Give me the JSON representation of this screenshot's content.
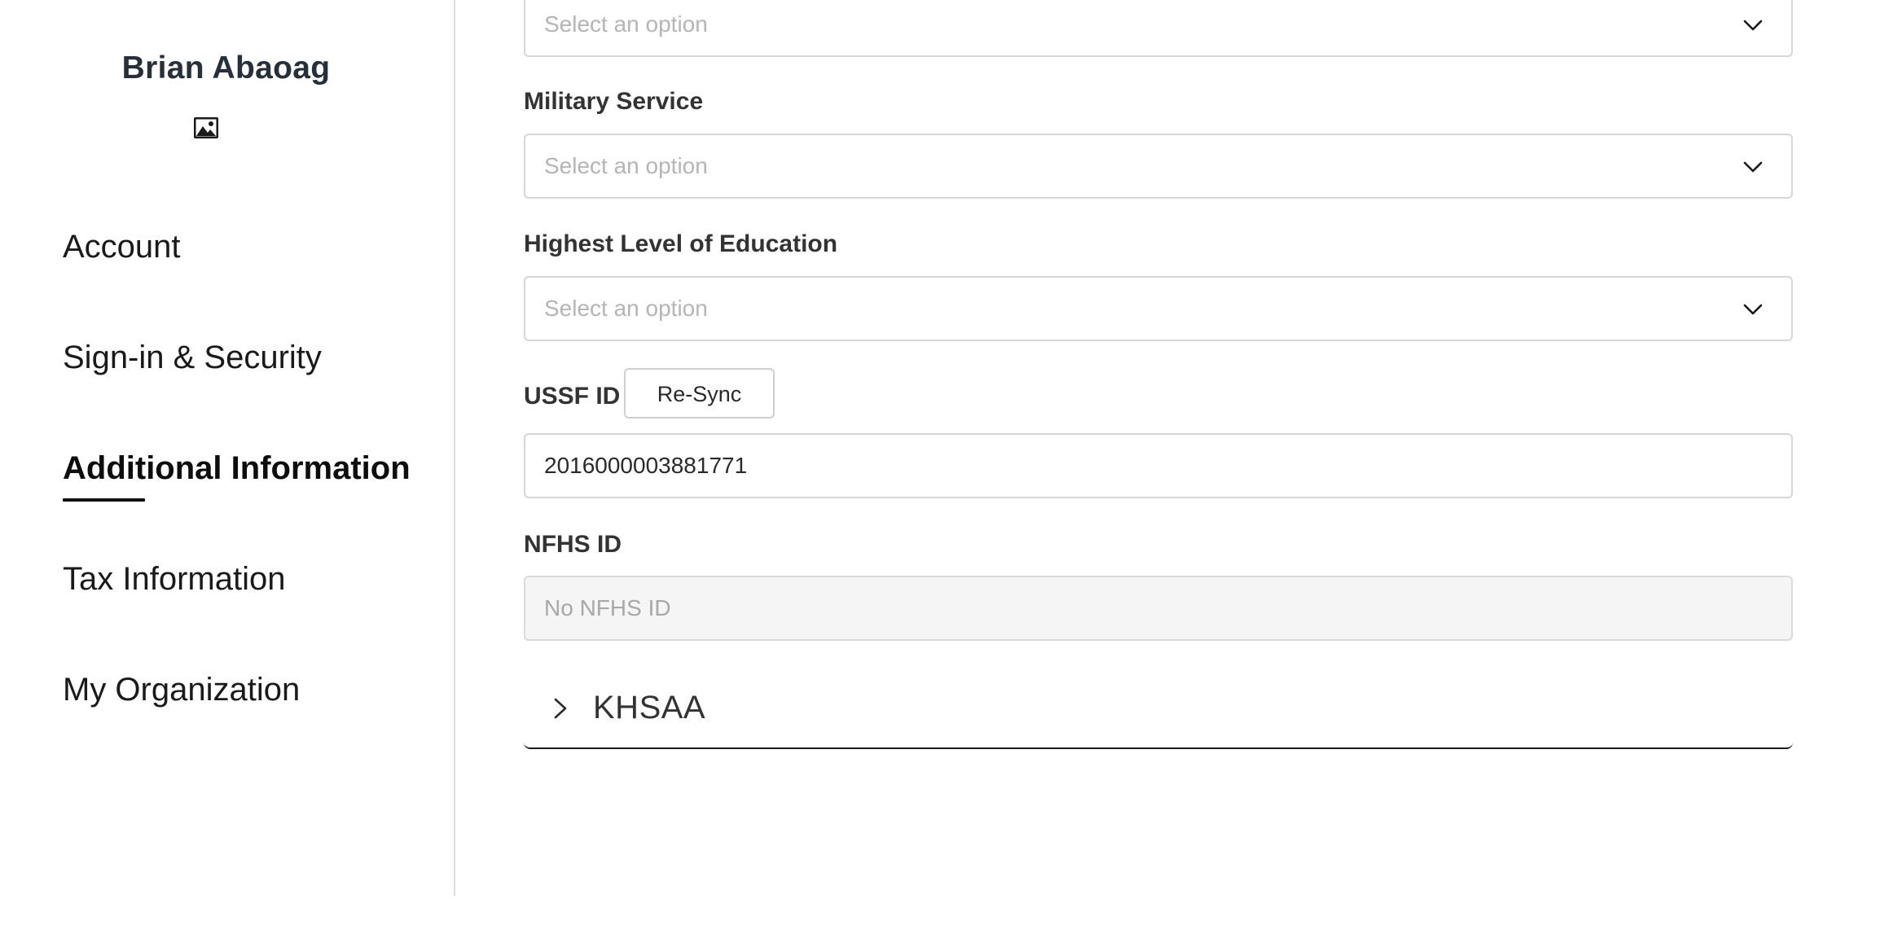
{
  "sidebar": {
    "profile_name": "Brian Abaoag",
    "avatar_icon": "image-icon",
    "items": [
      {
        "label": "Account"
      },
      {
        "label": "Sign-in & Security"
      },
      {
        "label": "Additional Information",
        "active": true
      },
      {
        "label": "Tax Information"
      },
      {
        "label": "My Organization"
      }
    ]
  },
  "form": {
    "top_select": {
      "placeholder": "Select an option"
    },
    "military_service": {
      "label": "Military Service",
      "placeholder": "Select an option"
    },
    "education": {
      "label": "Highest Level of Education",
      "placeholder": "Select an option"
    },
    "ussf": {
      "label": "USSF ID",
      "resync_label": "Re-Sync",
      "value": "2016000003881771"
    },
    "nfhs": {
      "label": "NFHS ID",
      "value": "No NFHS ID"
    },
    "khsaa": {
      "title": "KHSAA",
      "expanded": false
    }
  },
  "colors": {
    "active_underline": "#111111",
    "border": "#d6d6d6",
    "disabled_bg": "#f4f5f4",
    "placeholder": "#b5b5b5"
  }
}
